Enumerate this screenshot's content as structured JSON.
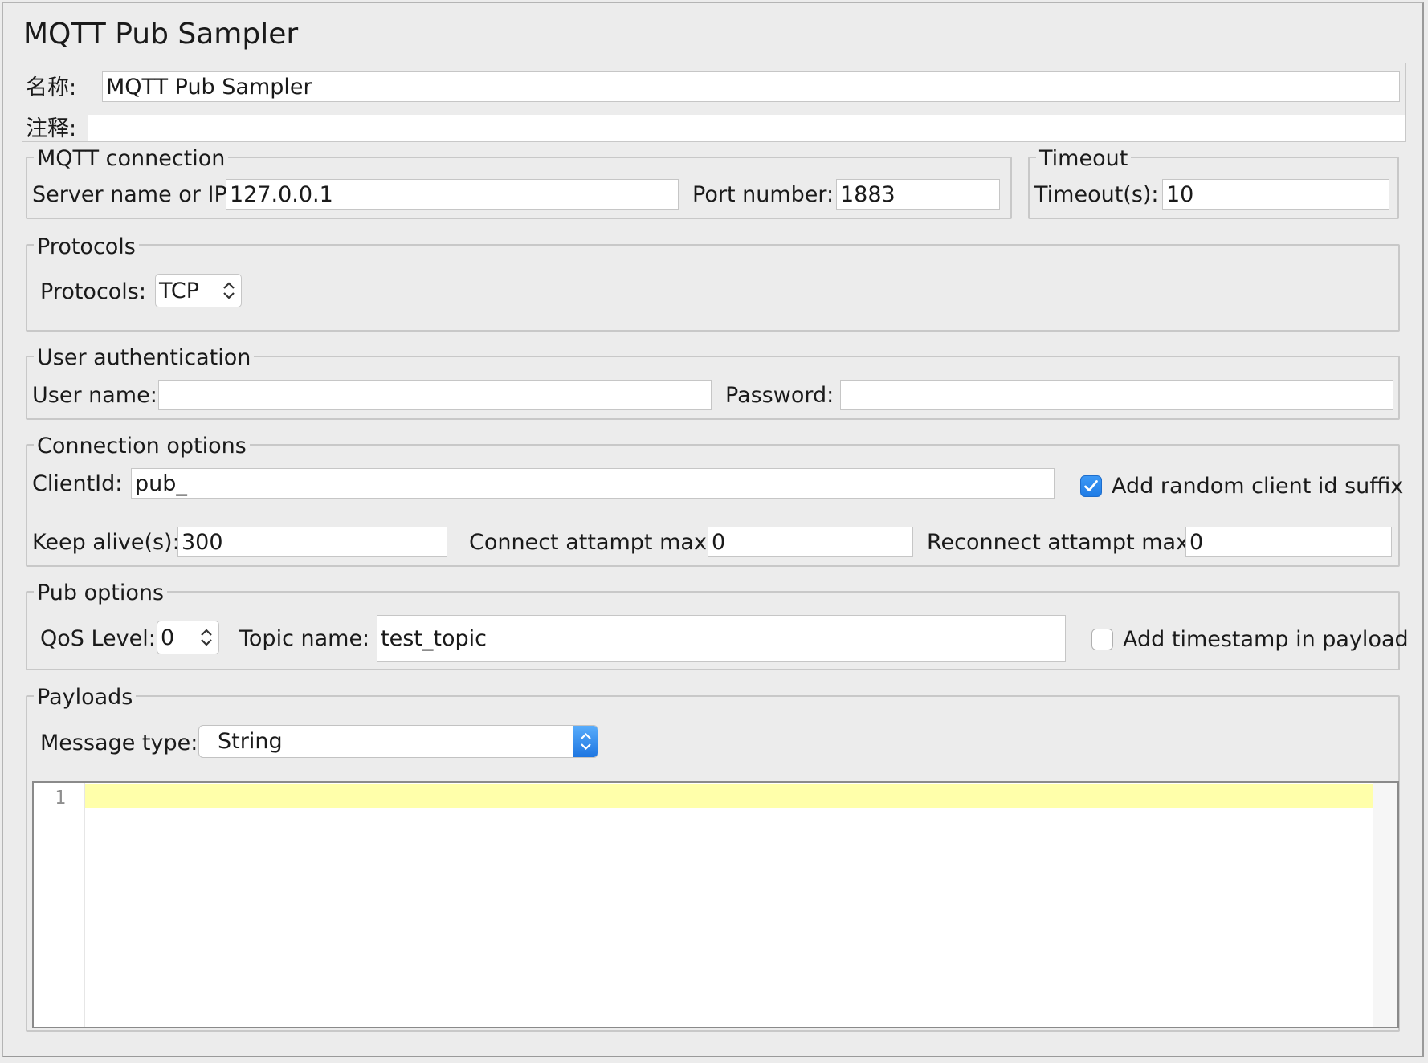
{
  "title": "MQTT Pub Sampler",
  "name_field": {
    "label": "名称:",
    "value": "MQTT Pub Sampler"
  },
  "comment_field": {
    "label": "注释:",
    "value": ""
  },
  "mqtt_connection": {
    "legend": "MQTT connection",
    "server_label": "Server name or IP:",
    "server_value": "127.0.0.1",
    "port_label": "Port number:",
    "port_value": "1883"
  },
  "timeout": {
    "legend": "Timeout",
    "label": "Timeout(s):",
    "value": "10"
  },
  "protocols": {
    "legend": "Protocols",
    "label": "Protocols:",
    "value": "TCP"
  },
  "user_auth": {
    "legend": "User authentication",
    "username_label": "User name:",
    "username_value": "",
    "password_label": "Password:",
    "password_value": ""
  },
  "connection_options": {
    "legend": "Connection options",
    "clientid_label": "ClientId:",
    "clientid_value": "pub_",
    "random_suffix_label": "Add random client id suffix",
    "random_suffix_checked": true,
    "keepalive_label": "Keep alive(s):",
    "keepalive_value": "300",
    "connect_max_label": "Connect attampt max:",
    "connect_max_value": "0",
    "reconnect_max_label": "Reconnect attampt max:",
    "reconnect_max_value": "0"
  },
  "pub_options": {
    "legend": "Pub options",
    "qos_label": "QoS Level:",
    "qos_value": "0",
    "topic_label": "Topic name:",
    "topic_value": "test_topic",
    "timestamp_label": "Add timestamp in payload",
    "timestamp_checked": false
  },
  "payloads": {
    "legend": "Payloads",
    "message_type_label": "Message type:",
    "message_type_value": "String",
    "editor_line_numbers": [
      "1"
    ],
    "editor_content": ""
  },
  "colors": {
    "background": "#ececec",
    "checkbox_accent": "#1f7ce6",
    "current_line_highlight": "#ffffaa"
  }
}
